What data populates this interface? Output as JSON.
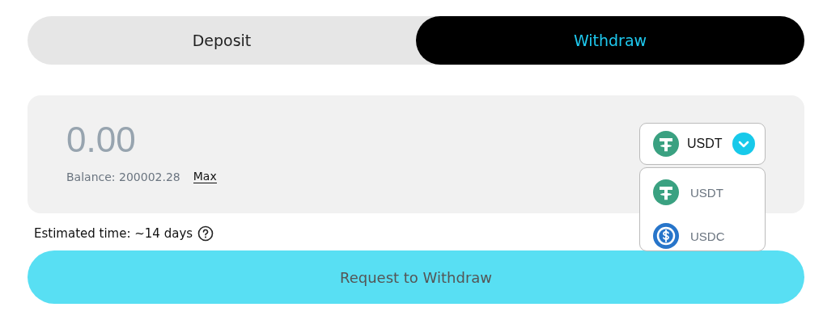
{
  "tabs": [
    {
      "label": "Deposit",
      "selected": false
    },
    {
      "label": "Withdraw",
      "selected": true
    }
  ],
  "amount": {
    "placeholder": "0.00"
  },
  "balance": "Balance: 200002.28",
  "max_link": "Max",
  "token_select": {
    "label": "USDT",
    "kind": "t-coin",
    "expanded": true
  },
  "token_options": [
    {
      "label": "USDT",
      "kind": "t-coin"
    },
    {
      "label": "USDC",
      "kind": "dollar-coin"
    }
  ],
  "estimated_time": "Estimated time: ~14 days",
  "submit_button": "Request to Withdraw"
}
